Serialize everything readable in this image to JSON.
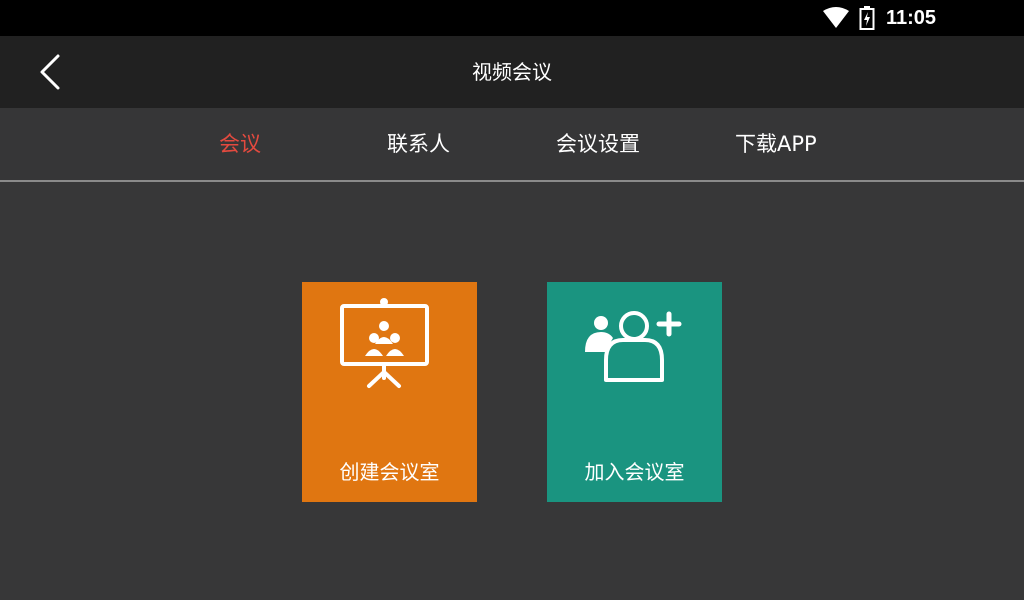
{
  "status_bar": {
    "time": "11:05",
    "icons": [
      "wifi-icon",
      "battery-charging-icon"
    ]
  },
  "app_bar": {
    "title": "视频会议",
    "back_icon": "back-arrow-icon"
  },
  "tabs": [
    {
      "label": "会议",
      "active": true
    },
    {
      "label": "联系人",
      "active": false
    },
    {
      "label": "会议设置",
      "active": false
    },
    {
      "label": "下载APP",
      "active": false
    }
  ],
  "tiles": [
    {
      "label": "创建会议室",
      "icon": "presentation-board-icon",
      "color": "#e07611"
    },
    {
      "label": "加入会议室",
      "icon": "add-user-icon",
      "color": "#1a9480"
    }
  ],
  "colors": {
    "status_bar": "#000000",
    "app_bar": "#212121",
    "background": "#373738",
    "active_tab": "#e34a3f"
  }
}
